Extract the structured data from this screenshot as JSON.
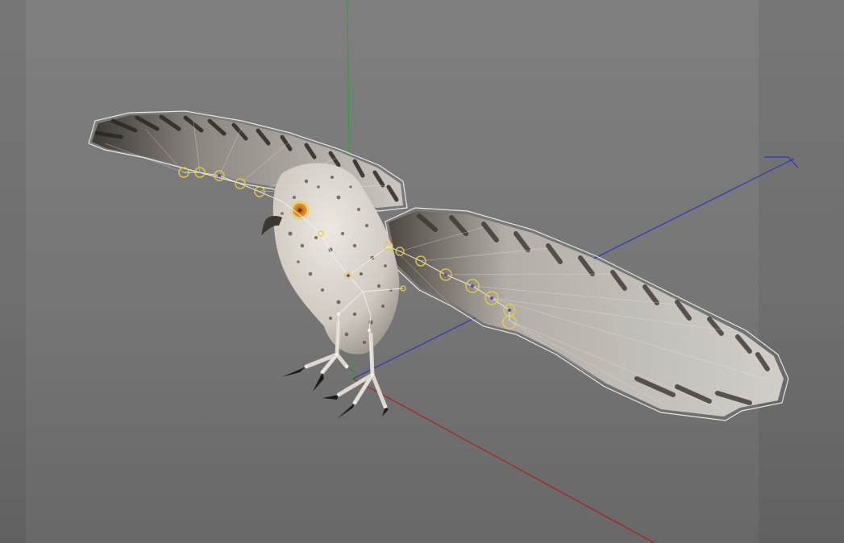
{
  "viewport": {
    "background_color": "#787878",
    "axis_colors": {
      "x": "#b01e1e",
      "y": "#1fae2a",
      "z": "#2b39b8"
    },
    "joint_color": "#e8d23a",
    "selection_outline_color": "#e6e6e6",
    "subject": "owl-rig"
  }
}
